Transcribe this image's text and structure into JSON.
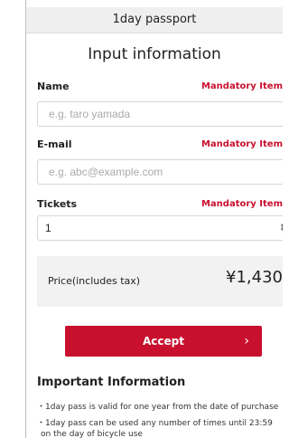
{
  "header": {
    "title": "1day passport"
  },
  "page": {
    "title": "Input information"
  },
  "form": {
    "name": {
      "label": "Name",
      "mandatory": "Mandatory Item",
      "placeholder": "e.g. taro yamada"
    },
    "email": {
      "label": "E-mail",
      "mandatory": "Mandatory Item",
      "placeholder": "e.g. abc@example.com"
    },
    "tickets": {
      "label": "Tickets",
      "mandatory": "Mandatory Item",
      "value": "1",
      "icon": "updown-chevron-icon"
    }
  },
  "price": {
    "label": "Price(includes tax)",
    "value": "¥1,430"
  },
  "accept": {
    "label": "Accept",
    "icon": "chevron-right-icon"
  },
  "important": {
    "title": "Important Information",
    "lines": [
      "・1day pass is valid for one year from the date of purchase",
      "・1day pass can be used any number of times until 23:59",
      "on the day of bicycle use"
    ]
  },
  "colors": {
    "accent": "#c8102e",
    "price_bg": "#f2f2f2",
    "header_bg": "#efefef"
  }
}
